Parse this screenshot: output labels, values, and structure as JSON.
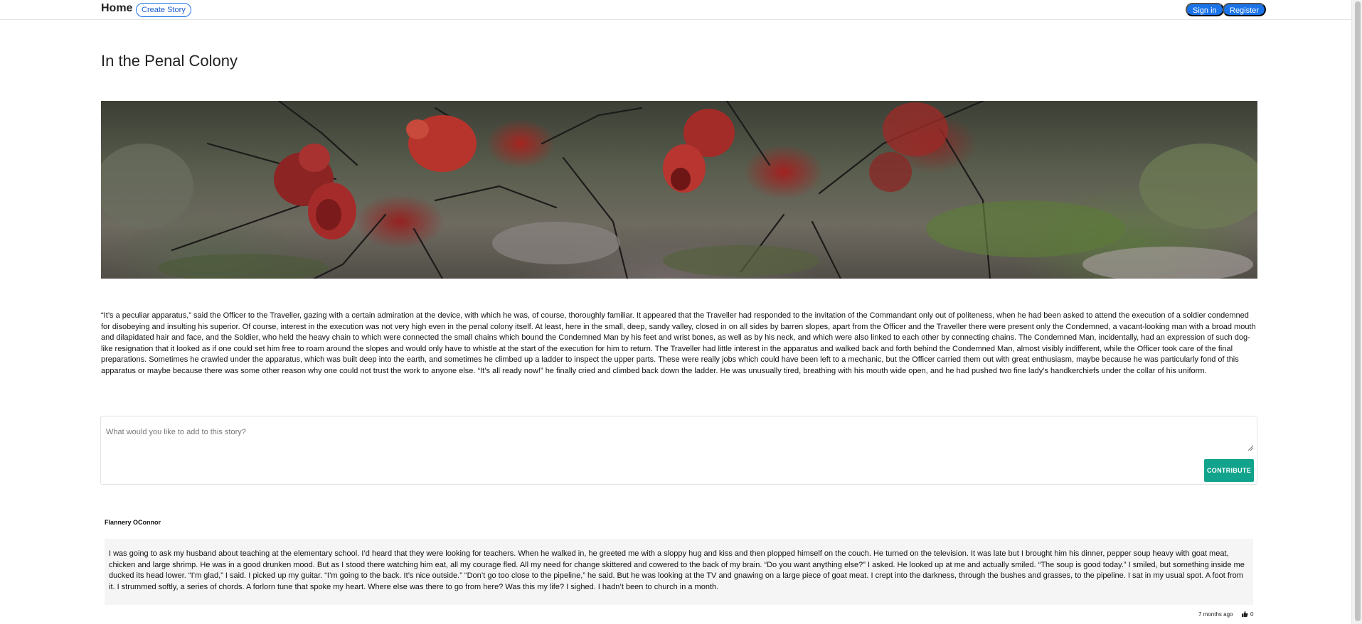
{
  "navbar": {
    "home_label": "Home",
    "create_story_label": "Create Story",
    "sign_in_label": "Sign in",
    "register_label": "Register",
    "accent_color": "#1a73e8"
  },
  "story": {
    "title": "In the Penal Colony",
    "hero_image": "red-ants-on-mossy-rock",
    "body": "“It’s a peculiar apparatus,” said the Officer to the Traveller, gazing with a certain admiration at the device, with which he was, of course, thoroughly familiar. It appeared that the Traveller had responded to the invitation of the Commandant only out of politeness, when he had been asked to attend the execution of a soldier condemned for disobeying and insulting his superior. Of course, interest in the execution was not very high even in the penal colony itself. At least, here in the small, deep, sandy valley, closed in on all sides by barren slopes, apart from the Officer and the Traveller there were present only the Condemned, a vacant-looking man with a broad mouth and dilapidated hair and face, and the Soldier, who held the heavy chain to which were connected the small chains which bound the Condemned Man by his feet and wrist bones, as well as by his neck, and which were also linked to each other by connecting chains. The Condemned Man, incidentally, had an expression of such dog-like resignation that it looked as if one could set him free to roam around the slopes and would only have to whistle at the start of the execution for him to return. The Traveller had little interest in the apparatus and walked back and forth behind the Condemned Man, almost visibly indifferent, while the Officer took care of the final preparations. Sometimes he crawled under the apparatus, which was built deep into the earth, and sometimes he climbed up a ladder to inspect the upper parts. These were really jobs which could have been left to a mechanic, but the Officer carried them out with great enthusiasm, maybe because he was particularly fond of this apparatus or maybe because there was some other reason why one could not trust the work to anyone else. “It’s all ready now!” he finally cried and climbed back down the ladder. He was unusually tired, breathing with his mouth wide open, and he had pushed two fine lady’s handkerchiefs under the collar of his uniform."
  },
  "contribute": {
    "placeholder": "What would you like to add to this story?",
    "value": "",
    "button_label": "CONTRIBUTE",
    "button_color": "#12a38c"
  },
  "contributions": [
    {
      "author": "Flannery OConnor",
      "text": "I was going to ask my husband about teaching at the elementary school. I’d heard that they were looking for teachers. When he walked in, he greeted me with a sloppy hug and kiss and then plopped himself on the couch. He turned on the television. It was late but I brought him his dinner, pepper soup heavy with goat meat, chicken and large shrimp. He was in a good drunken mood. But as I stood there watching him eat, all my courage fled. All my need for change skittered and cowered to the back of my brain. “Do you want anything else?” I asked. He looked up at me and actually smiled. “The soup is good today.” I smiled, but something inside me ducked its head lower. “I’m glad,” I said. I picked up my guitar. “I’m going to the back. It’s nice outside.” “Don’t go too close to the pipeline,” he said. But he was looking at the TV and gnawing on a large piece of goat meat. I crept into the darkness, through the bushes and grasses, to the pipeline. I sat in my usual spot. A foot from it. I strummed softly, a series of chords. A forlorn tune that spoke my heart. Where else was there to go from here? Was this my life? I sighed. I hadn’t been to church in a month.",
      "time": "7 months ago",
      "likes": "0",
      "like_icon": "thumbs-up-icon"
    }
  ]
}
